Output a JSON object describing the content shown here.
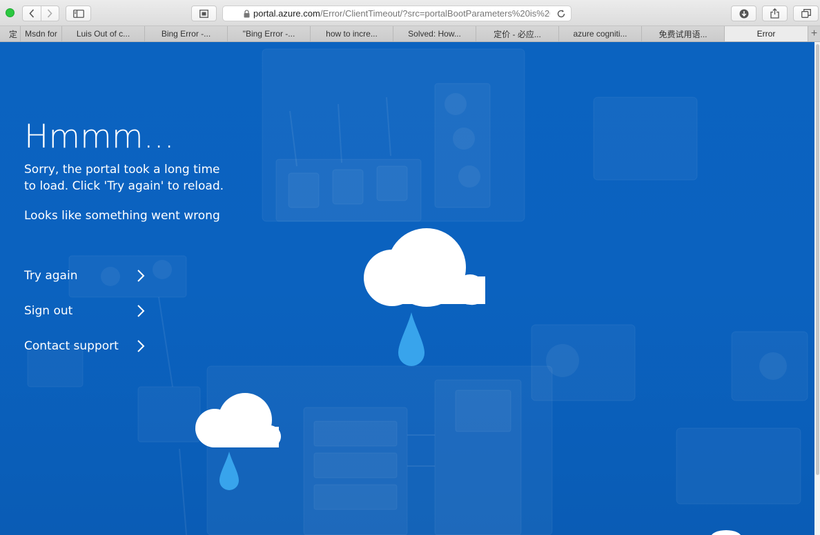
{
  "browser": {
    "address": {
      "host": "portal.azure.com",
      "path": "/Error/ClientTimeout/?src=portalBootParameters%20is%20"
    },
    "tabs": [
      {
        "label": "定",
        "size": "tiny"
      },
      {
        "label": "Msdn for",
        "size": "narrow"
      },
      {
        "label": "Luis Out of c...",
        "size": "std"
      },
      {
        "label": "Bing Error -...",
        "size": "std"
      },
      {
        "label": "\"Bing Error -...",
        "size": "std"
      },
      {
        "label": "how to incre...",
        "size": "std"
      },
      {
        "label": "Solved: How...",
        "size": "std"
      },
      {
        "label": "定价 - 必应...",
        "size": "std"
      },
      {
        "label": "azure cogniti...",
        "size": "std"
      },
      {
        "label": "免费试用语...",
        "size": "std"
      },
      {
        "label": "Error",
        "size": "last",
        "active": true
      }
    ],
    "new_tab_label": "+"
  },
  "page": {
    "title": "Hmmm...",
    "message": "Sorry, the portal took a long time to load. Click 'Try again' to reload.",
    "sub_message": "Looks like something went wrong",
    "actions": [
      {
        "label": "Try again"
      },
      {
        "label": "Sign out"
      },
      {
        "label": "Contact support"
      }
    ],
    "colors": {
      "background": "#0b63c0",
      "cloud": "#ffffff",
      "drop": "#3aa3ea"
    }
  }
}
